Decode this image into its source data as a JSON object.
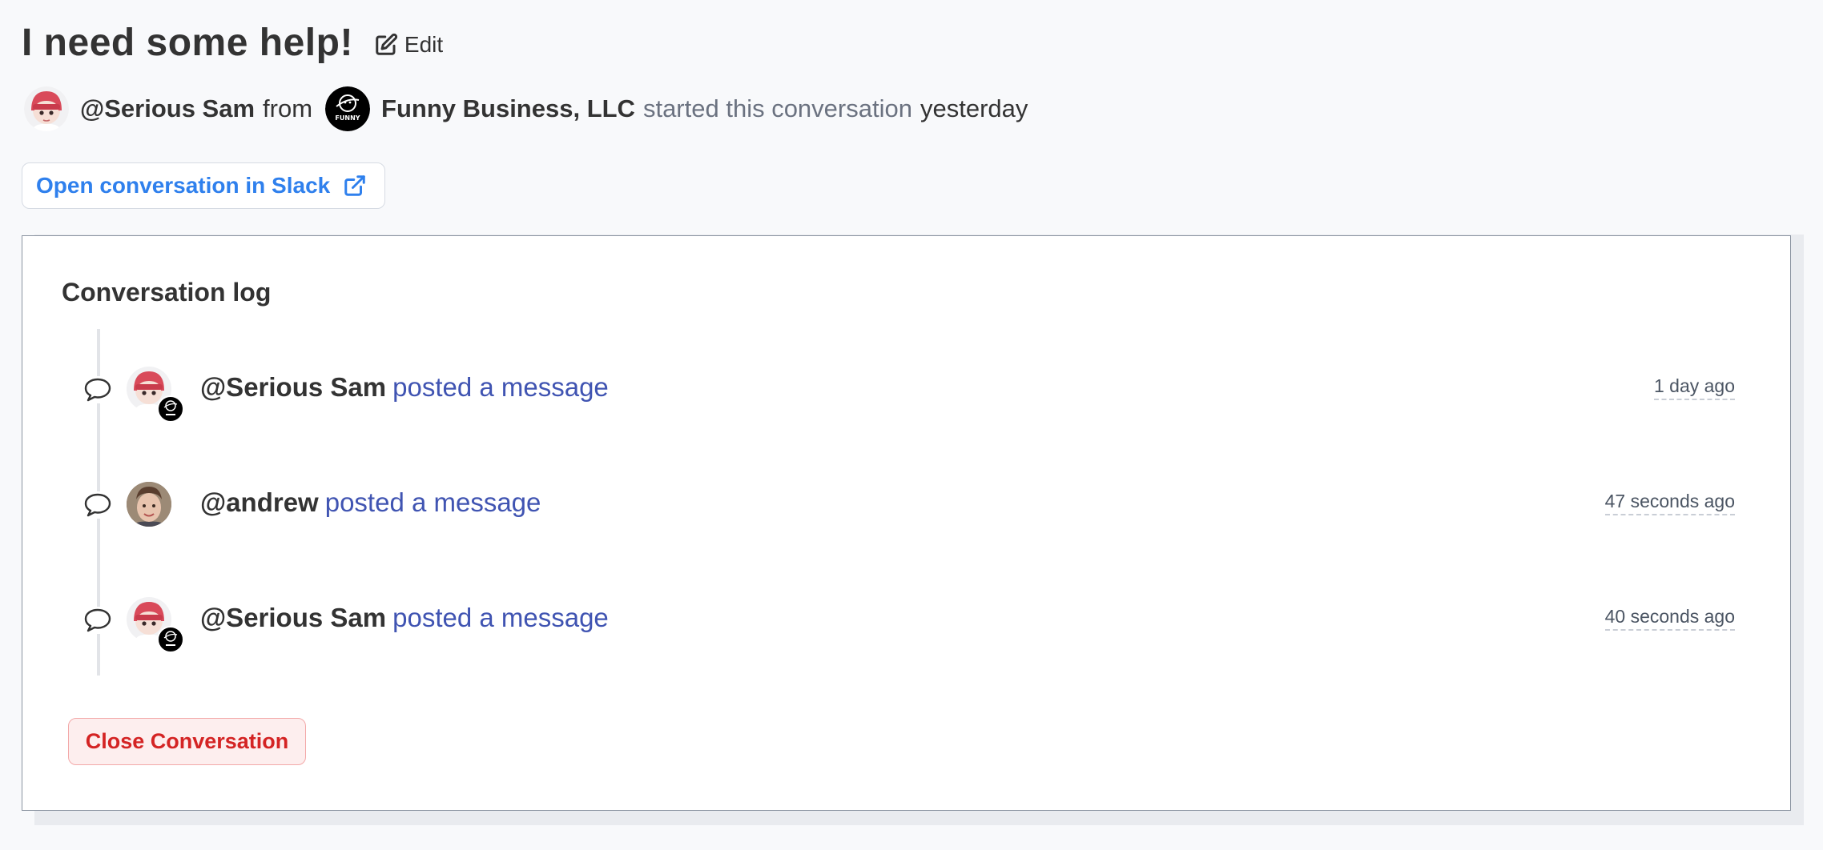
{
  "header": {
    "title": "I need some help!",
    "edit_label": "Edit"
  },
  "meta": {
    "user": "@Serious Sam",
    "from": "from",
    "org_name": "Funny Business, LLC",
    "org_logo_text": "FUNNY",
    "started": "started this conversation",
    "when": "yesterday"
  },
  "slack_button": {
    "label": "Open conversation in Slack"
  },
  "log": {
    "title": "Conversation log",
    "entries": [
      {
        "user": "@Serious Sam",
        "action": "posted a message",
        "time": "1 day ago",
        "avatar": "serious-sam",
        "has_org_badge": true
      },
      {
        "user": "@andrew",
        "action": "posted a message",
        "time": "47 seconds ago",
        "avatar": "andrew",
        "has_org_badge": false
      },
      {
        "user": "@Serious Sam",
        "action": "posted a message",
        "time": "40 seconds ago",
        "avatar": "serious-sam",
        "has_org_badge": true
      }
    ]
  },
  "close_button": {
    "label": "Close Conversation"
  },
  "colors": {
    "background": "#f8f9fb",
    "link_blue": "#2f80ed",
    "action_blue": "#4054b2",
    "danger_red": "#d42424",
    "danger_bg": "#fdeeee"
  },
  "icons": {
    "edit": "edit-icon",
    "external_link": "external-link-icon",
    "message": "message-bubble-icon"
  }
}
